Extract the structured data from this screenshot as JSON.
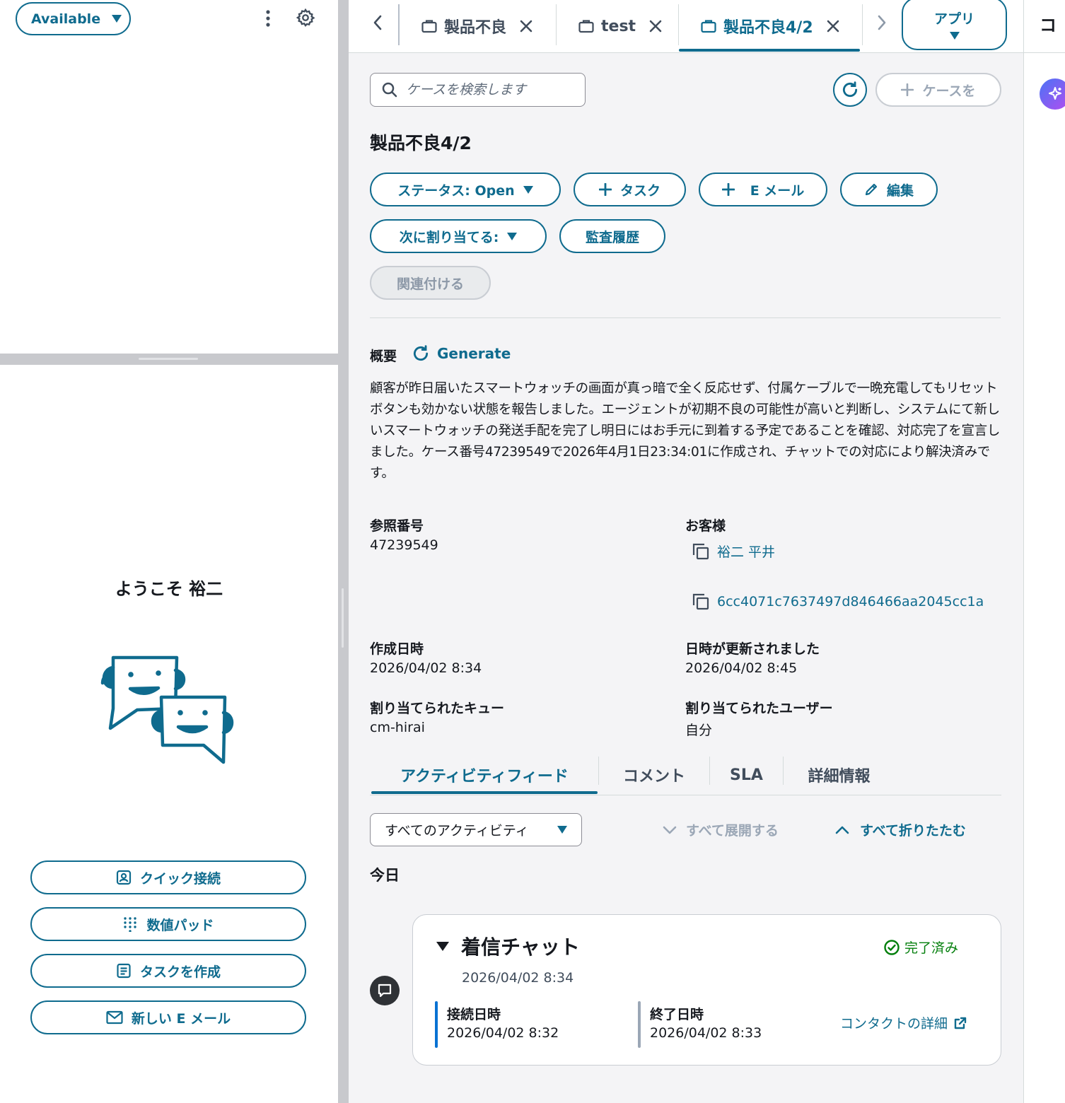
{
  "agent": {
    "status_label": "Available"
  },
  "welcome": {
    "text": "ようこそ 裕二"
  },
  "side_actions": [
    {
      "label": "クイック接続",
      "icon": "contact-card-icon"
    },
    {
      "label": "数値パッド",
      "icon": "keypad-icon"
    },
    {
      "label": "タスクを作成",
      "icon": "task-icon"
    },
    {
      "label": "新しい E メール",
      "icon": "envelope-icon"
    }
  ],
  "tabs": [
    {
      "label": "製品不良",
      "icon": "briefcase-icon",
      "active": false
    },
    {
      "label": "test",
      "icon": "briefcase-icon",
      "active": false
    },
    {
      "label": "製品不良4/2",
      "icon": "briefcase-icon",
      "active": true
    }
  ],
  "apps_button": {
    "label": "アプリ"
  },
  "search": {
    "placeholder": "ケースを検索します"
  },
  "create_case": {
    "label": "ケースを"
  },
  "case": {
    "title": "製品不良4/2",
    "actions": {
      "status": "ステータス: Open",
      "task": "タスク",
      "email": "E メール",
      "edit": "編集",
      "assign_next": "次に割り当てる:",
      "audit_history": "監査履歴",
      "link": "関連付ける"
    },
    "summary": {
      "label": "概要",
      "generate_label": "Generate",
      "text": "顧客が昨日届いたスマートウォッチの画面が真っ暗で全く反応せず、付属ケーブルで一晩充電してもリセットボタンも効かない状態を報告しました。エージェントが初期不良の可能性が高いと判断し、システムにて新しいスマートウォッチの発送手配を完了し明日にはお手元に到着する予定であることを確認、対応完了を宣言しました。ケース番号47239549で2026年4月1日23:34:01に作成され、チャットでの対応により解決済みです。"
    },
    "fields": {
      "reference_label": "参照番号",
      "reference_value": "47239549",
      "customer_label": "お客様",
      "customer_name": "裕二 平井",
      "customer_id": "6cc4071c7637497d846466aa2045cc1a",
      "created_label": "作成日時",
      "created_value": "2026/04/02 8:34",
      "updated_label": "日時が更新されました",
      "updated_value": "2026/04/02 8:45",
      "queue_label": "割り当てられたキュー",
      "queue_value": "cm-hirai",
      "user_label": "割り当てられたユーザー",
      "user_value": "自分"
    }
  },
  "detail_tabs": [
    {
      "label": "アクティビティフィード",
      "active": true
    },
    {
      "label": "コメント",
      "active": false
    },
    {
      "label": "SLA",
      "active": false
    },
    {
      "label": "詳細情報",
      "active": false
    }
  ],
  "feed": {
    "filter_value": "すべてのアクティビティ",
    "expand_all": "すべて展開する",
    "collapse_all": "すべて折りたたむ",
    "day_label": "今日",
    "items": [
      {
        "title": "着信チャット",
        "time": "2026/04/02 8:34",
        "status": "完了済み",
        "connected_label": "接続日時",
        "connected_value": "2026/04/02 8:32",
        "ended_label": "終了日時",
        "ended_value": "2026/04/02 8:33",
        "details_link": "コンタクトの詳細"
      }
    ]
  },
  "right_panel": {
    "title_partial": "コ"
  },
  "colors": {
    "accent": "#0f6b8e",
    "success": "#037f0c",
    "disabled": "#9ba7b6",
    "connected_bar": "#0972d3",
    "ended_bar": "#9ba7b6"
  }
}
